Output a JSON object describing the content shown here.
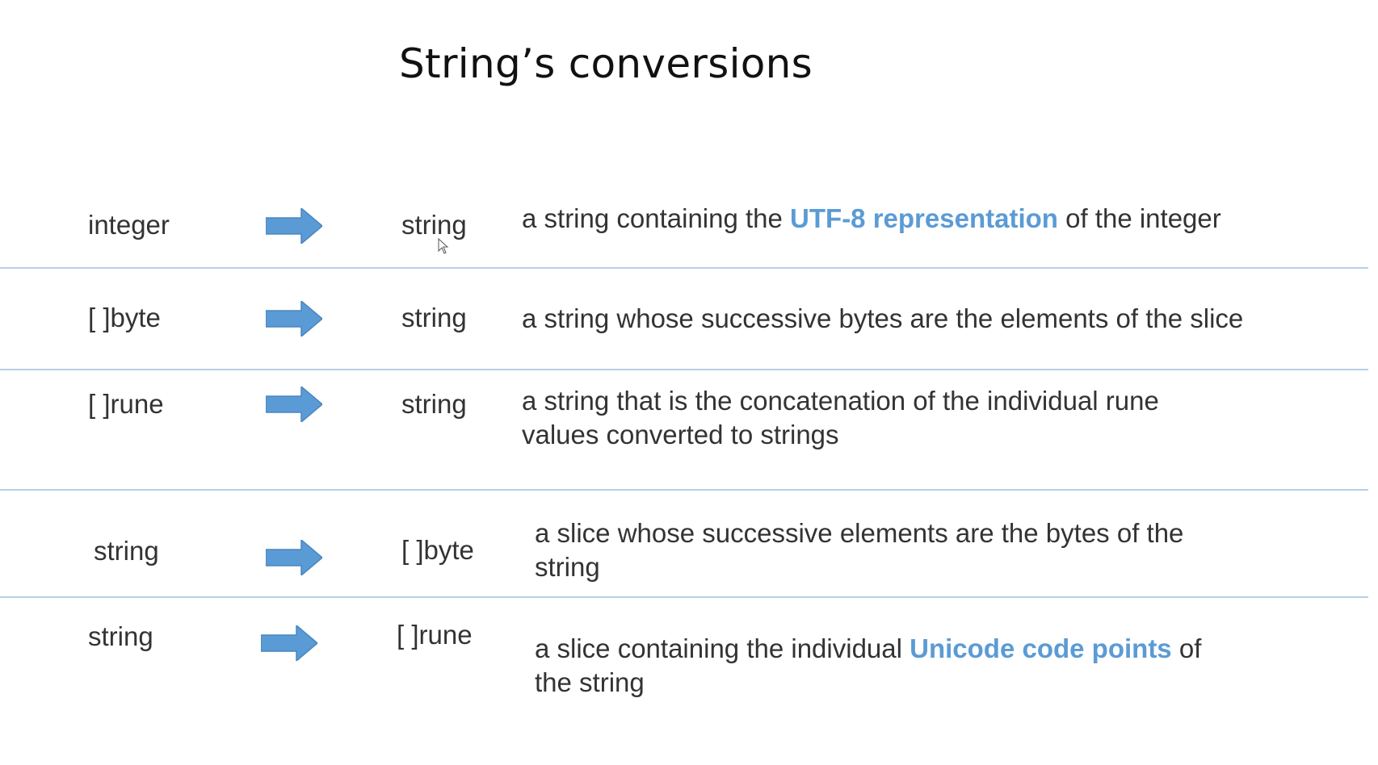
{
  "title": "String’s conversions",
  "rows": [
    {
      "from": "integer",
      "to": "string",
      "desc_parts": [
        "a string containing the ",
        "UTF-8 representation",
        " of the integer"
      ]
    },
    {
      "from": "[ ]byte",
      "to": "string",
      "desc_parts": [
        "a string whose successive bytes are the elements of the slice"
      ]
    },
    {
      "from": "[ ]rune",
      "to": "string",
      "desc_parts": [
        "a string that is the concatenation of the individual rune",
        "values converted to strings"
      ]
    },
    {
      "from": "string",
      "to": "[ ]byte",
      "desc_parts": [
        "a slice whose successive elements are the bytes of the",
        "string"
      ]
    },
    {
      "from": "string",
      "to": "[ ]rune",
      "desc_parts": [
        "a slice containing the individual ",
        "Unicode code points",
        " of",
        "the string"
      ]
    }
  ],
  "colors": {
    "accent": "#5b9bd5",
    "divider": "#b7cfe6",
    "text": "#333333"
  },
  "icons": {
    "arrow": "right-arrow-icon",
    "cursor": "mouse-cursor-icon"
  }
}
